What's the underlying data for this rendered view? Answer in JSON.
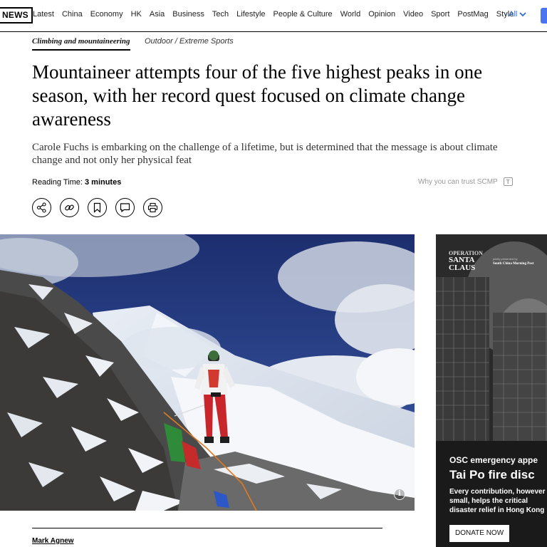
{
  "nav": {
    "brand": "NEWS",
    "items": [
      "Latest",
      "China",
      "Economy",
      "HK",
      "Asia",
      "Business",
      "Tech",
      "Lifestyle",
      "People & Culture",
      "World",
      "Opinion",
      "Video",
      "Sport",
      "PostMag",
      "Style"
    ],
    "all_label": "- All",
    "accent_color": "#2a6dd9"
  },
  "article": {
    "tag_primary": "Climbing and mountaineering",
    "tag_secondary": "Outdoor / Extreme Sports",
    "headline": "Mountaineer attempts four of the five highest peaks in one season, with her record quest focused on climate change awareness",
    "subhead": "Carole Fuchs is embarking on the challenge of a lifetime, but is determined that the message is about climate change and not only her physical feat",
    "reading_label": "Reading Time: ",
    "reading_value": "3 minutes",
    "trust_label": "Why you can trust SCMP",
    "share_buttons": [
      "share-icon",
      "link-icon",
      "bookmark-icon",
      "comment-icon",
      "print-icon"
    ],
    "author": "Mark Agnew"
  },
  "ad": {
    "logo_line1": "OPERATION",
    "logo_line2": "SANTA",
    "logo_line3": "CLAUS",
    "presented_by": "jointly presented by",
    "paper": "South China Morning Post",
    "eyebrow": "OSC emergency appe",
    "title": "Tai Po fire disc",
    "body": "Every contribution, however or small, helps the critical disaster relief in Hong Kong",
    "cta": "DONATE NOW"
  }
}
